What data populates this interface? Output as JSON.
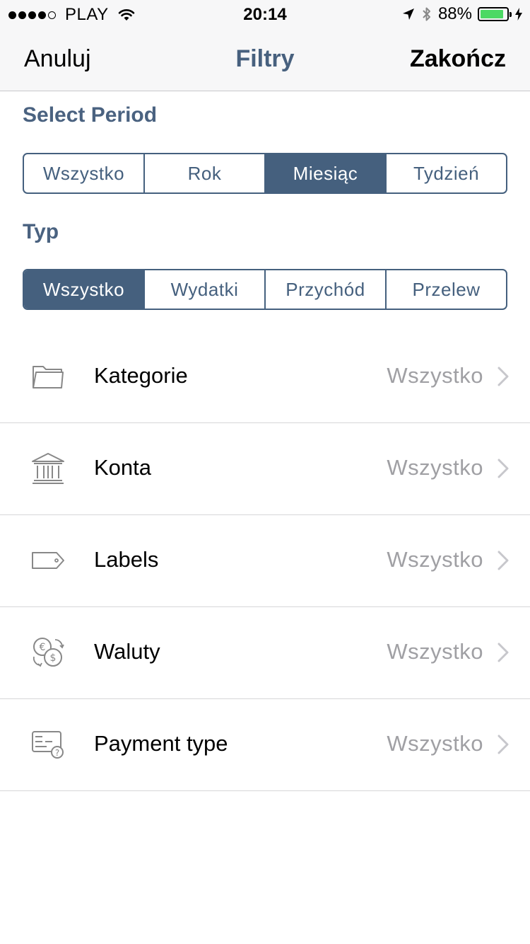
{
  "status_bar": {
    "carrier": "PLAY",
    "time": "20:14",
    "battery": "88%",
    "battery_level": 0.88,
    "signal_bars_filled": 4,
    "signal_bars_total": 5
  },
  "nav": {
    "cancel_label": "Anuluj",
    "title": "Filtry",
    "done_label": "Zakończ"
  },
  "period": {
    "title": "Select Period",
    "options": [
      "Wszystko",
      "Rok",
      "Miesiąc",
      "Tydzień"
    ],
    "selected": "Miesiąc"
  },
  "type": {
    "title": "Typ",
    "options": [
      "Wszystko",
      "Wydatki",
      "Przychód",
      "Przelew"
    ],
    "selected": "Wszystko"
  },
  "rows": [
    {
      "icon": "folder-icon",
      "label": "Kategorie",
      "value": "Wszystko"
    },
    {
      "icon": "bank-icon",
      "label": "Konta",
      "value": "Wszystko"
    },
    {
      "icon": "tag-icon",
      "label": "Labels",
      "value": "Wszystko"
    },
    {
      "icon": "currency-exchange-icon",
      "label": "Waluty",
      "value": "Wszystko"
    },
    {
      "icon": "payment-card-icon",
      "label": "Payment type",
      "value": "Wszystko"
    }
  ],
  "colors": {
    "accent": "#45607e",
    "battery_green": "#4cd964",
    "secondary_text": "#a0a0a4"
  }
}
